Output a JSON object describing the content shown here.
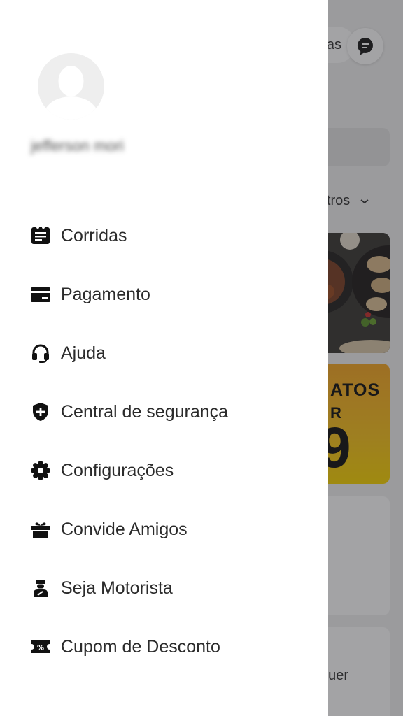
{
  "background": {
    "pill_label": "as",
    "filters_label": "iltros",
    "promo_line1": "ATOS",
    "promo_line2": "R",
    "promo_number": "9",
    "card_text": "guer"
  },
  "drawer": {
    "user_name": "jefferson mori",
    "menu": [
      {
        "icon": "receipt-icon",
        "label": "Corridas"
      },
      {
        "icon": "wallet-icon",
        "label": "Pagamento"
      },
      {
        "icon": "headset-icon",
        "label": "Ajuda"
      },
      {
        "icon": "shield-icon",
        "label": "Central de segurança"
      },
      {
        "icon": "gear-icon",
        "label": "Configurações"
      },
      {
        "icon": "gift-icon",
        "label": "Convide Amigos"
      },
      {
        "icon": "driver-icon",
        "label": "Seja Motorista"
      },
      {
        "icon": "coupon-icon",
        "label": "Cupom de Desconto"
      }
    ]
  }
}
